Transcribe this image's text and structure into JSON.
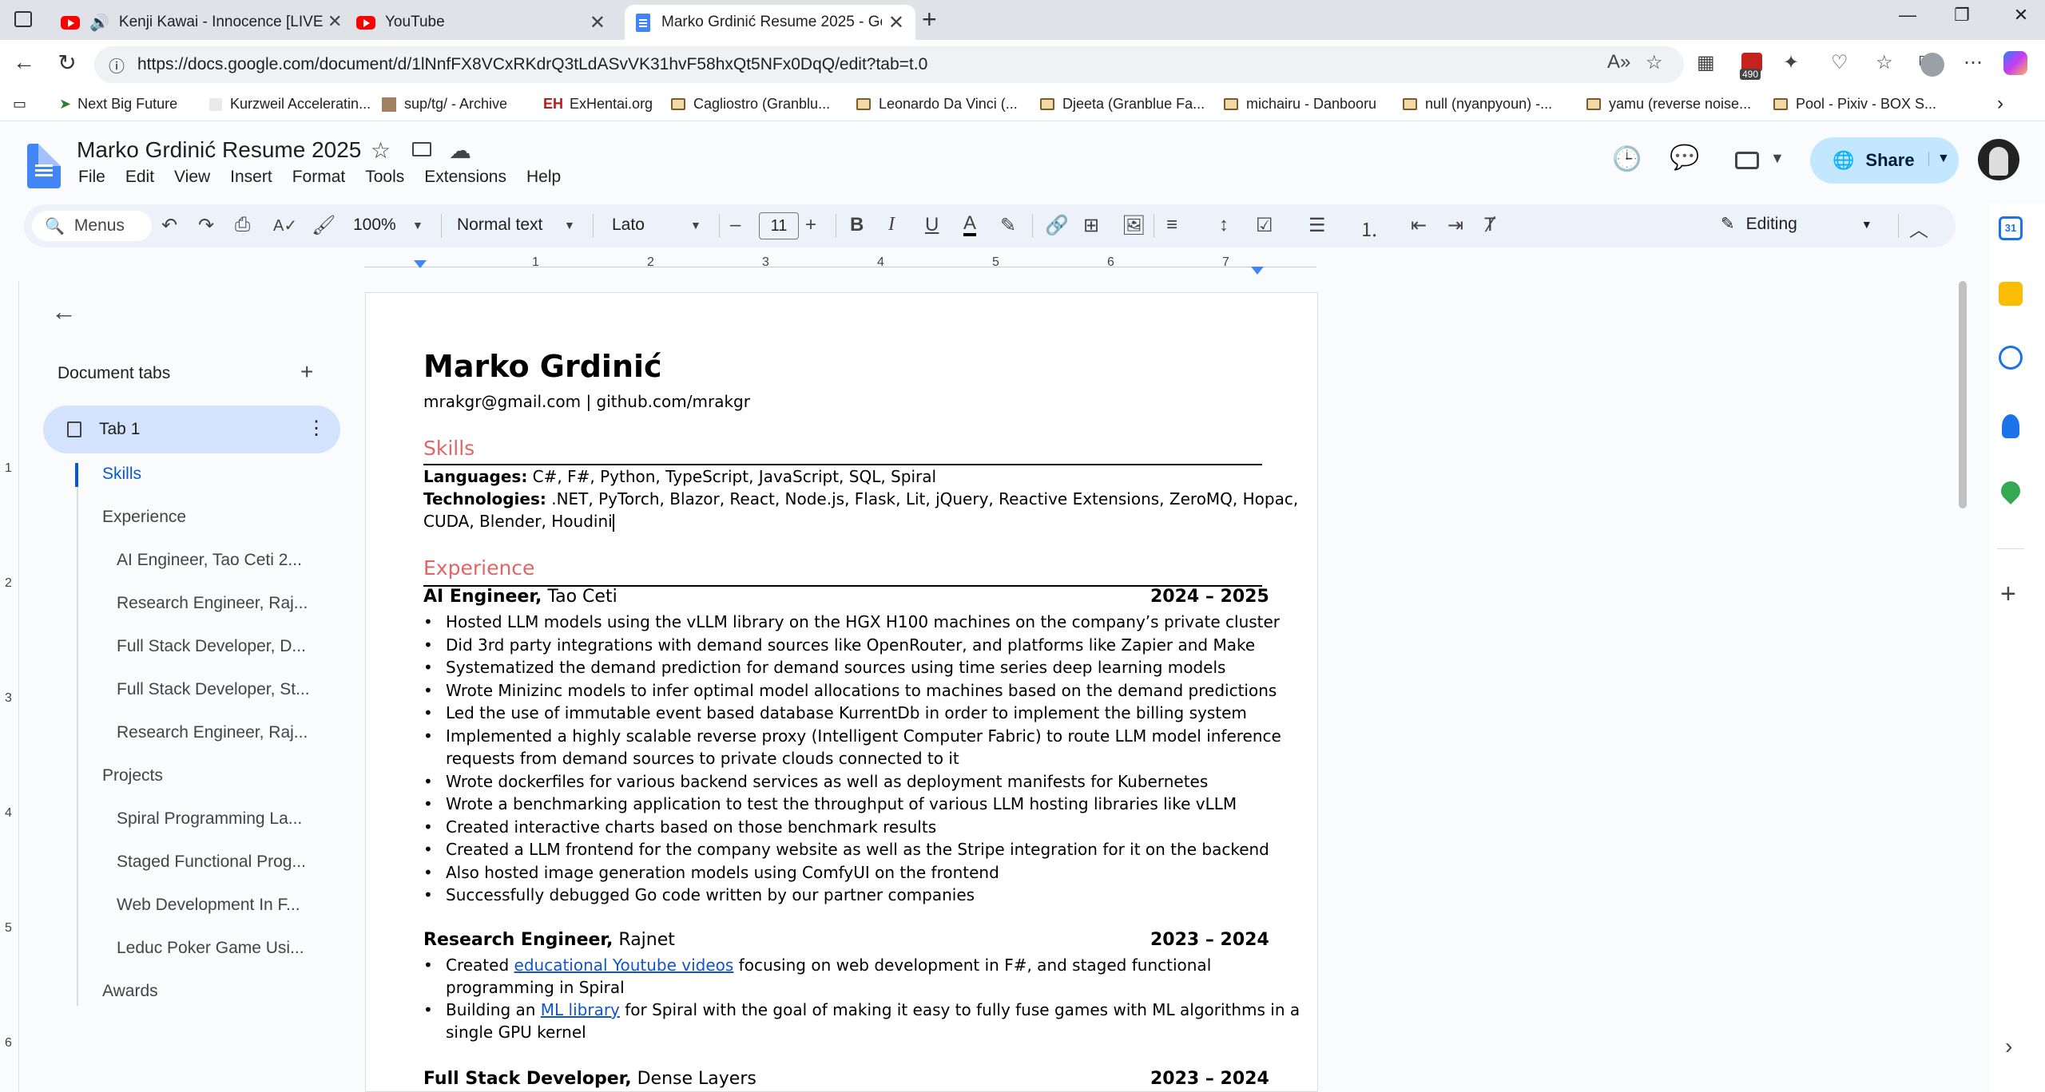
{
  "browser": {
    "tabs": [
      {
        "title": "Kenji Kawai - Innocence [LIVE"
      },
      {
        "title": "YouTube"
      },
      {
        "title": "Marko Grdinić Resume 2025 - Go"
      }
    ],
    "url": "https://docs.google.com/document/d/1lNnfFX8VCxRKdrQ3tLdASvVK31hvF58hxQt5NFx0DqQ/edit?tab=t.0",
    "extension_badge": "490",
    "bookmarks": [
      "Next Big Future",
      "Kurzweil Acceleratin...",
      "sup/tg/ - Archive",
      "ExHentai.org",
      "Cagliostro (Granblu...",
      "Leonardo Da Vinci (...",
      "Djeeta (Granblue Fa...",
      "michairu - Danbooru",
      "null (nyanpyoun) -...",
      "yamu (reverse noise...",
      "Pool - Pixiv - BOX S..."
    ]
  },
  "docs": {
    "title": "Marko Grdinić Resume 2025",
    "menu": [
      "File",
      "Edit",
      "View",
      "Insert",
      "Format",
      "Tools",
      "Extensions",
      "Help"
    ],
    "share_label": "Share",
    "toolbar": {
      "menus_label": "Menus",
      "zoom": "100%",
      "style": "Normal text",
      "font": "Lato",
      "font_size": "11",
      "mode": "Editing"
    },
    "ruler_numbers": [
      "1",
      "2",
      "3",
      "4",
      "5",
      "6",
      "7"
    ],
    "left_ruler_numbers": [
      "1",
      "2",
      "3",
      "4",
      "5",
      "6"
    ]
  },
  "sidebar": {
    "heading": "Document tabs",
    "tab": "Tab 1",
    "outline": [
      {
        "label": "Skills",
        "level": 1,
        "active": true
      },
      {
        "label": "Experience",
        "level": 1
      },
      {
        "label": "AI Engineer, Tao Ceti 2...",
        "level": 2
      },
      {
        "label": "Research Engineer, Raj...",
        "level": 2
      },
      {
        "label": "Full Stack Developer, D...",
        "level": 2
      },
      {
        "label": "Full Stack Developer, St...",
        "level": 2
      },
      {
        "label": "Research Engineer, Raj...",
        "level": 2
      },
      {
        "label": "Projects",
        "level": 1
      },
      {
        "label": "Spiral Programming La...",
        "level": 2
      },
      {
        "label": "Staged Functional Prog...",
        "level": 2
      },
      {
        "label": "Web Development In F...",
        "level": 2
      },
      {
        "label": "Leduc Poker Game Usi...",
        "level": 2
      },
      {
        "label": "Awards",
        "level": 1
      }
    ]
  },
  "resume": {
    "name": "Marko Grdinić",
    "contact": "mrakgr@gmail.com | github.com/mrakgr",
    "skills_heading": "Skills",
    "languages_label": "Languages:",
    "languages": " C#, F#, Python, TypeScript, JavaScript, SQL, Spiral",
    "technologies_label": "Technologies:",
    "technologies_line1": " .NET, PyTorch, Blazor, React, Node.js, Flask, Lit, jQuery, Reactive Extensions, ZeroMQ, Hopac,",
    "technologies_line2": "CUDA, Blender, Houdini",
    "experience_heading": "Experience",
    "jobs": [
      {
        "title": "AI Engineer,",
        "company": " Tao Ceti",
        "dates": "2024 – 2025",
        "bullets": [
          "Hosted LLM models using the vLLM library on the HGX H100 machines on the company’s private cluster",
          "Did 3rd party integrations with demand sources like OpenRouter, and platforms like Zapier and Make",
          "Systematized the demand prediction for demand sources using time series deep learning models",
          "Wrote Minizinc models to infer optimal model allocations to machines based on the demand predictions",
          "Led the use of immutable event based database KurrentDb in order to implement the billing system",
          "Implemented a highly scalable reverse proxy (Intelligent Computer Fabric) to route LLM model inference",
          "requests from demand sources to private clouds connected to it",
          "Wrote dockerfiles for various backend services as well as deployment manifests for Kubernetes",
          "Wrote a benchmarking application to test the throughput of various LLM hosting libraries like vLLM",
          "Created interactive charts based on those benchmark results",
          "Created a LLM frontend for the company website as well as the Stripe integration for it on the backend",
          "Also hosted image generation models using ComfyUI on the frontend",
          "Successfully debugged Go code written by our partner companies"
        ]
      },
      {
        "title": "Research Engineer,",
        "company": " Rajnet",
        "dates": "2023 – 2024",
        "b1_pre": "Created ",
        "b1_link": "educational Youtube videos",
        "b1_post": " focusing on web development in F#, and staged functional",
        "b1_line2": "programming in Spiral",
        "b2_pre": "Building an ",
        "b2_link": "ML library",
        "b2_post": " for Spiral with the goal of making it easy to fully fuse games with ML algorithms in a",
        "b2_line2": "single GPU kernel"
      },
      {
        "title": "Full Stack Developer,",
        "company": " Dense Layers",
        "dates": "2023 – 2024"
      }
    ]
  }
}
